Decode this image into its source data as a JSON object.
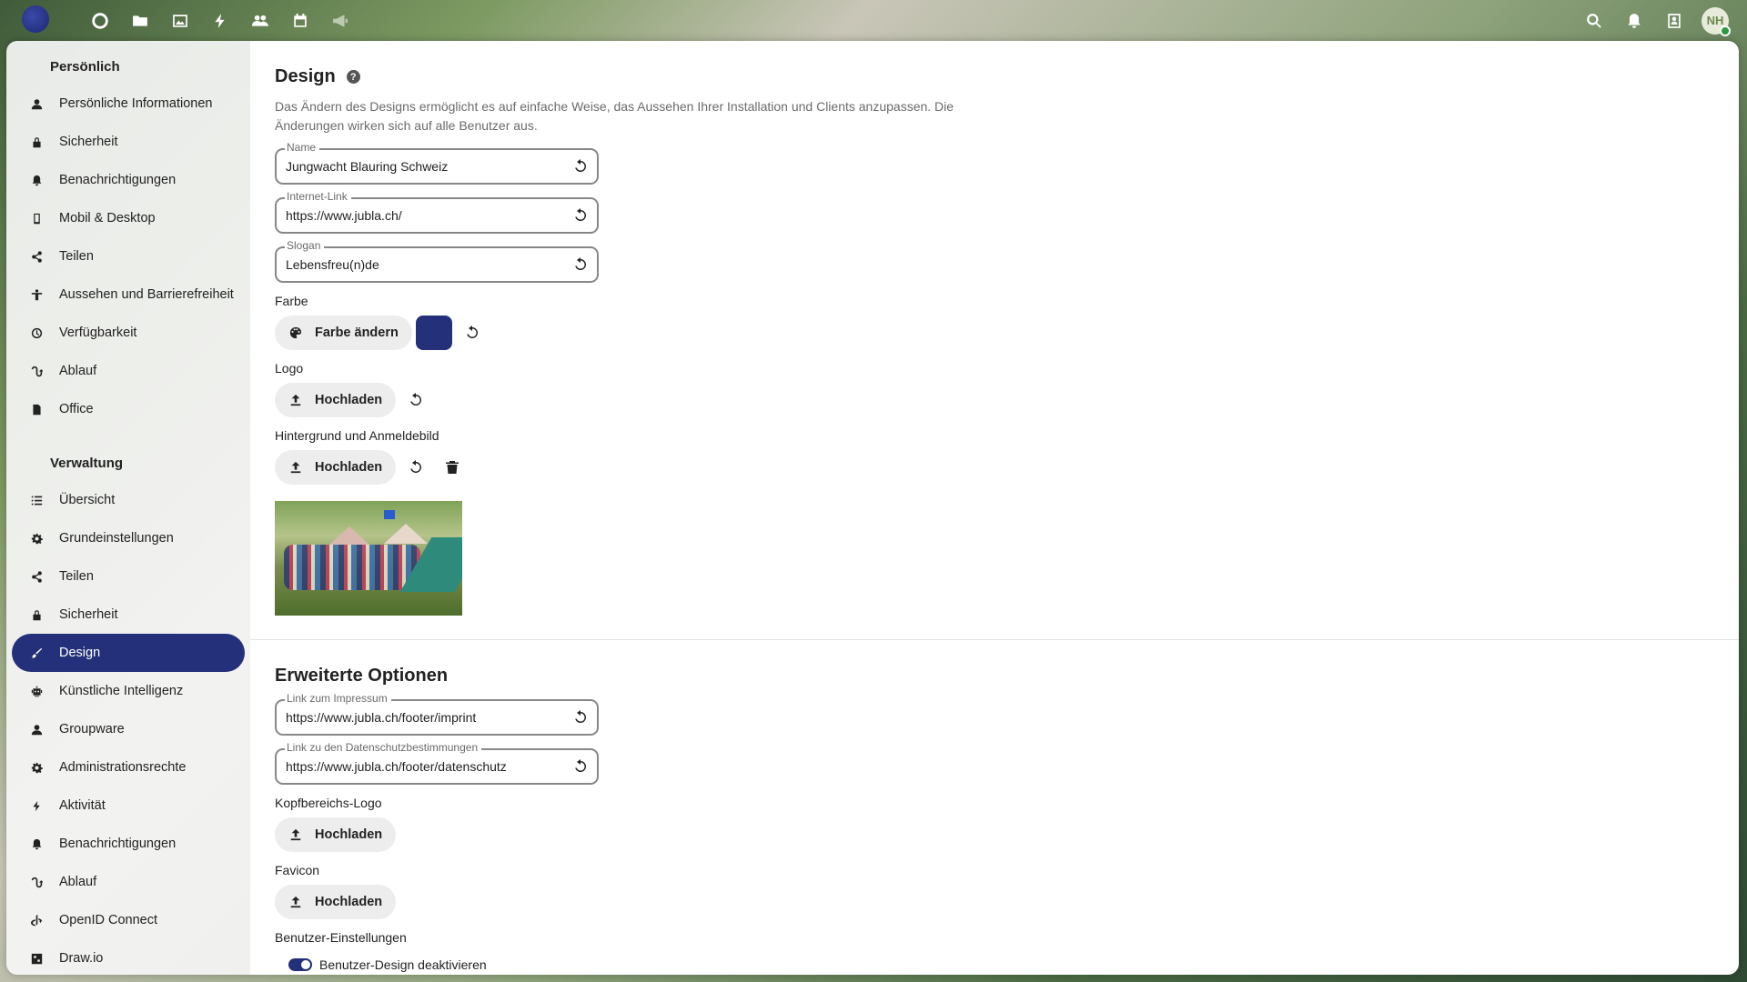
{
  "header": {
    "apps": [
      {
        "name": "dashboard-icon"
      },
      {
        "name": "files-icon"
      },
      {
        "name": "photos-icon"
      },
      {
        "name": "activity-icon"
      },
      {
        "name": "contacts-icon"
      },
      {
        "name": "calendar-icon"
      },
      {
        "name": "announcements-icon"
      }
    ],
    "avatar_initials": "NH"
  },
  "sidebar": {
    "personal_caption": "Persönlich",
    "personal_items": [
      {
        "label": "Persönliche Informationen",
        "icon": "user-icon"
      },
      {
        "label": "Sicherheit",
        "icon": "lock-icon"
      },
      {
        "label": "Benachrichtigungen",
        "icon": "bell-icon"
      },
      {
        "label": "Mobil & Desktop",
        "icon": "phone-icon"
      },
      {
        "label": "Teilen",
        "icon": "share-icon"
      },
      {
        "label": "Aussehen und Barrierefreiheit",
        "icon": "accessibility-icon"
      },
      {
        "label": "Verfügbarkeit",
        "icon": "clock-icon"
      },
      {
        "label": "Ablauf",
        "icon": "flow-icon"
      },
      {
        "label": "Office",
        "icon": "document-icon"
      }
    ],
    "admin_caption": "Verwaltung",
    "admin_items": [
      {
        "label": "Übersicht",
        "icon": "list-icon"
      },
      {
        "label": "Grundeinstellungen",
        "icon": "gear-icon"
      },
      {
        "label": "Teilen",
        "icon": "share-icon"
      },
      {
        "label": "Sicherheit",
        "icon": "lock-icon"
      },
      {
        "label": "Design",
        "icon": "paint-icon"
      },
      {
        "label": "Künstliche Intelligenz",
        "icon": "robot-icon"
      },
      {
        "label": "Groupware",
        "icon": "user-icon"
      },
      {
        "label": "Administrationsrechte",
        "icon": "gear-icon"
      },
      {
        "label": "Aktivität",
        "icon": "bolt-icon"
      },
      {
        "label": "Benachrichtigungen",
        "icon": "bell-icon"
      },
      {
        "label": "Ablauf",
        "icon": "flow-icon"
      },
      {
        "label": "OpenID Connect",
        "icon": "openid-icon"
      },
      {
        "label": "Draw.io",
        "icon": "drawio-icon"
      }
    ]
  },
  "design": {
    "title": "Design",
    "help": "?",
    "description": "Das Ändern des Designs ermöglicht es auf einfache Weise, das Aussehen Ihrer Installation und Clients anzupassen. Die Änderungen wirken sich auf alle Benutzer aus.",
    "name_label": "Name",
    "name_value": "Jungwacht Blauring Schweiz",
    "link_label": "Internet-Link",
    "link_value": "https://www.jubla.ch/",
    "slogan_label": "Slogan",
    "slogan_value": "Lebensfreu(n)de",
    "color_label": "Farbe",
    "color_button": "Farbe ändern",
    "color_value": "#24317a",
    "logo_label": "Logo",
    "logo_button": "Hochladen",
    "background_label": "Hintergrund und Anmeldebild",
    "background_button": "Hochladen"
  },
  "advanced": {
    "title": "Erweiterte Optionen",
    "imprint_label": "Link zum Impressum",
    "imprint_value": "https://www.jubla.ch/footer/imprint",
    "privacy_label": "Link zu den Datenschutzbestimmungen",
    "privacy_value": "https://www.jubla.ch/footer/datenschutz",
    "header_logo_label": "Kopfbereichs-Logo",
    "header_logo_button": "Hochladen",
    "favicon_label": "Favicon",
    "favicon_button": "Hochladen",
    "user_settings_label": "Benutzer-Einstellungen",
    "disable_user_theme_label": "Benutzer-Design deaktivieren",
    "disable_user_theme_checked": true
  }
}
